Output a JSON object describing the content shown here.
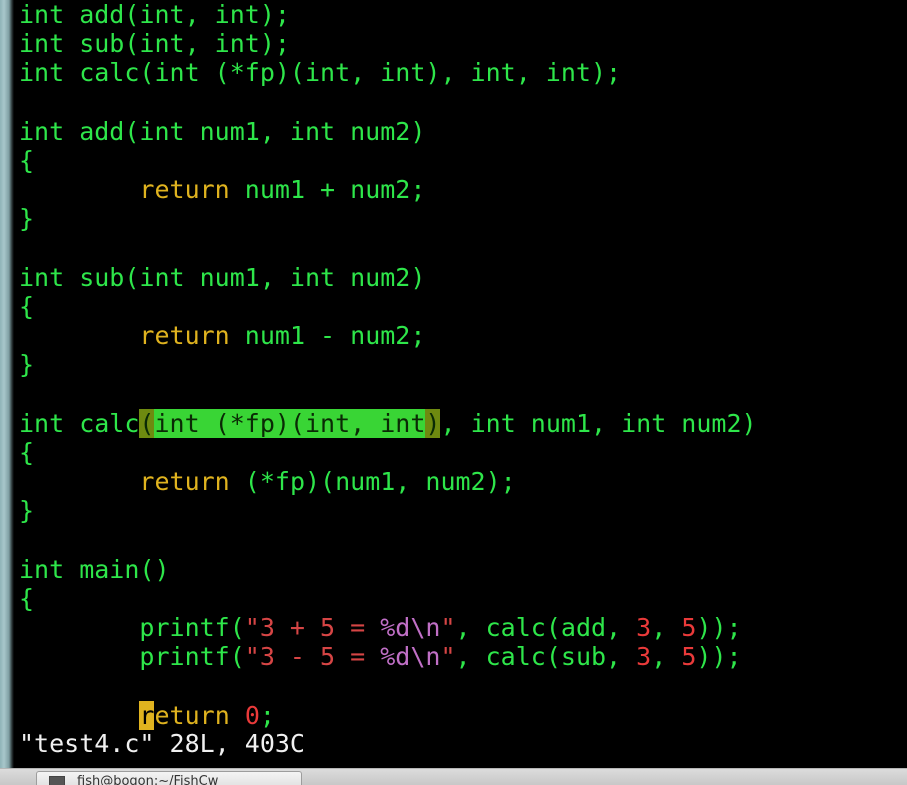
{
  "editor": {
    "lines": [
      [
        {
          "t": "int",
          "c": "type"
        },
        {
          "t": " add(int, int);",
          "c": "text"
        }
      ],
      [
        {
          "t": "int",
          "c": "type"
        },
        {
          "t": " sub(int, int);",
          "c": "text"
        }
      ],
      [
        {
          "t": "int",
          "c": "type"
        },
        {
          "t": " calc(int (*fp)(int, int), int, int);",
          "c": "text"
        }
      ],
      [],
      [
        {
          "t": "int",
          "c": "type"
        },
        {
          "t": " add(int num1, int num2)",
          "c": "text"
        }
      ],
      [
        {
          "t": "{",
          "c": "text"
        }
      ],
      [
        {
          "t": "        ",
          "c": "text"
        },
        {
          "t": "return",
          "c": "kw"
        },
        {
          "t": " num1 + num2;",
          "c": "text"
        }
      ],
      [
        {
          "t": "}",
          "c": "text"
        }
      ],
      [],
      [
        {
          "t": "int",
          "c": "type"
        },
        {
          "t": " sub(int num1, int num2)",
          "c": "text"
        }
      ],
      [
        {
          "t": "{",
          "c": "text"
        }
      ],
      [
        {
          "t": "        ",
          "c": "text"
        },
        {
          "t": "return",
          "c": "kw"
        },
        {
          "t": " num1 - num2;",
          "c": "text"
        }
      ],
      [
        {
          "t": "}",
          "c": "text"
        }
      ],
      [],
      [
        {
          "t": "int",
          "c": "type"
        },
        {
          "t": " calc",
          "c": "text"
        },
        {
          "t": "(",
          "c": "hl-match"
        },
        {
          "t": "int (*fp)(int, int",
          "c": "hl"
        },
        {
          "t": ")",
          "c": "hl-match"
        },
        {
          "t": ", int num1, int num2)",
          "c": "text"
        }
      ],
      [
        {
          "t": "{",
          "c": "text"
        }
      ],
      [
        {
          "t": "        ",
          "c": "text"
        },
        {
          "t": "return",
          "c": "kw"
        },
        {
          "t": " (*fp)(num1, num2);",
          "c": "text"
        }
      ],
      [
        {
          "t": "}",
          "c": "text"
        }
      ],
      [],
      [
        {
          "t": "int",
          "c": "type"
        },
        {
          "t": " main()",
          "c": "text"
        }
      ],
      [
        {
          "t": "{",
          "c": "text"
        }
      ],
      [
        {
          "t": "        printf(",
          "c": "text"
        },
        {
          "t": "\"3 + 5 = ",
          "c": "str"
        },
        {
          "t": "%d\\n",
          "c": "fmt"
        },
        {
          "t": "\"",
          "c": "str"
        },
        {
          "t": ", calc(add, ",
          "c": "text"
        },
        {
          "t": "3",
          "c": "num"
        },
        {
          "t": ", ",
          "c": "text"
        },
        {
          "t": "5",
          "c": "num"
        },
        {
          "t": "));",
          "c": "text"
        }
      ],
      [
        {
          "t": "        printf(",
          "c": "text"
        },
        {
          "t": "\"3 - 5 = ",
          "c": "str"
        },
        {
          "t": "%d\\n",
          "c": "fmt"
        },
        {
          "t": "\"",
          "c": "str"
        },
        {
          "t": ", calc(sub, ",
          "c": "text"
        },
        {
          "t": "3",
          "c": "num"
        },
        {
          "t": ", ",
          "c": "text"
        },
        {
          "t": "5",
          "c": "num"
        },
        {
          "t": "));",
          "c": "text"
        }
      ],
      [],
      [
        {
          "t": "        ",
          "c": "text"
        },
        {
          "t": "r",
          "c": "cursor"
        },
        {
          "t": "eturn",
          "c": "kw"
        },
        {
          "t": " ",
          "c": "text"
        },
        {
          "t": "0",
          "c": "num"
        },
        {
          "t": ";",
          "c": "text"
        }
      ]
    ],
    "status_line": "\"test4.c\" 28L, 403C"
  },
  "taskbar": {
    "window_label": "fish@bogon:~/FishCw"
  },
  "colors": {
    "background": "#000000",
    "code_text": "#2ee64a",
    "keyword": "#e0b31f",
    "string": "#d64545",
    "format_spec": "#c06fc6",
    "number": "#ea3a3a",
    "highlight": "#39d535"
  }
}
